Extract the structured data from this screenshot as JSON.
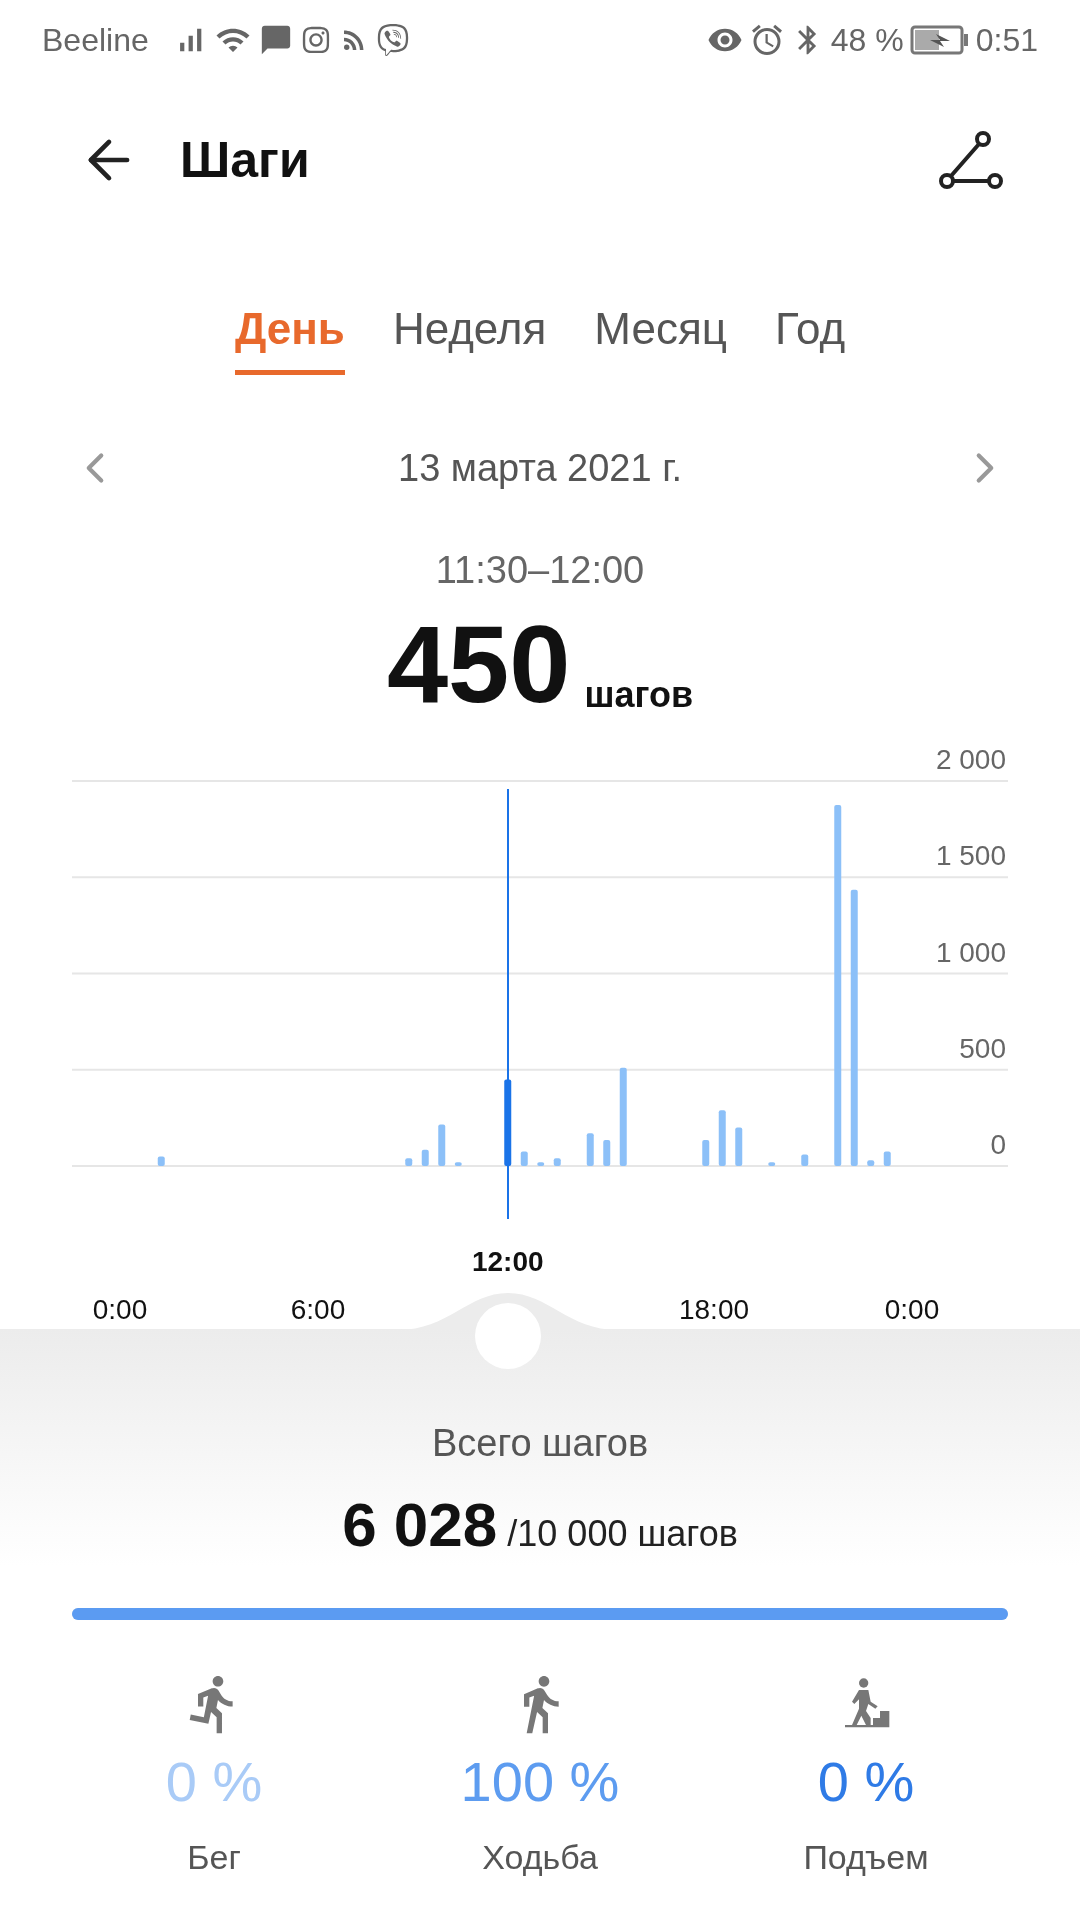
{
  "status_bar": {
    "carrier": "Beeline",
    "battery": "48 %",
    "time": "0:51"
  },
  "header": {
    "title": "Шаги"
  },
  "tabs": [
    {
      "label": "День",
      "selected": true
    },
    {
      "label": "Неделя",
      "selected": false
    },
    {
      "label": "Месяц",
      "selected": false
    },
    {
      "label": "Год",
      "selected": false
    }
  ],
  "date": "13 марта 2021 г.",
  "selection": {
    "range": "11:30–12:00",
    "value": "450",
    "unit": "шагов"
  },
  "cursor": {
    "label": "12:00"
  },
  "chart_data": {
    "type": "bar",
    "grid": true,
    "stacked": true,
    "x": [
      0.25,
      0.75,
      1.25,
      1.75,
      2.25,
      2.75,
      3.25,
      3.75,
      4.25,
      4.75,
      5.25,
      5.75,
      6.25,
      6.75,
      7.25,
      7.75,
      8.25,
      8.75,
      9.25,
      9.75,
      10.25,
      10.75,
      11.25,
      11.75,
      12.25,
      12.75,
      13.25,
      13.75,
      14.25,
      14.75,
      15.25,
      15.75,
      16.25,
      16.75,
      17.25,
      17.75,
      18.25,
      18.75,
      19.25,
      19.75,
      20.25,
      20.75,
      21.25,
      21.75,
      22.25,
      22.75,
      23.25,
      23.75
    ],
    "series": [
      {
        "color": "#8cc0f8",
        "values": [
          0,
          0,
          50,
          0,
          0,
          0,
          0,
          0,
          0,
          0,
          0,
          0,
          0,
          0,
          0,
          0,
          0,
          40,
          85,
          215,
          20,
          0,
          0,
          null,
          75,
          20,
          40,
          0,
          170,
          135,
          510,
          0,
          0,
          0,
          0,
          135,
          290,
          200,
          0,
          20,
          0,
          60,
          0,
          1875,
          1435,
          30,
          75,
          0
        ]
      },
      {
        "color": "#1a73e8",
        "values": [
          null,
          null,
          null,
          null,
          null,
          null,
          null,
          null,
          null,
          null,
          null,
          null,
          null,
          null,
          null,
          null,
          null,
          null,
          null,
          null,
          null,
          null,
          null,
          450,
          null,
          null,
          null,
          null,
          null,
          null,
          null,
          null,
          null,
          null,
          null,
          null,
          null,
          null,
          null,
          null,
          null,
          null,
          null,
          null,
          null,
          null,
          null,
          null
        ]
      }
    ],
    "xlim": [
      -1.4545,
      26.909
    ],
    "ylim": [
      0,
      2000
    ],
    "xticks": [
      {
        "value": 0,
        "label": "0:00"
      },
      {
        "value": 6,
        "label": "6:00"
      },
      {
        "value": 18,
        "label": "18:00"
      },
      {
        "value": 24,
        "label": "0:00"
      }
    ],
    "yticks": [
      {
        "value": 0,
        "label": "0"
      },
      {
        "value": 500,
        "label": "500"
      },
      {
        "value": 1000,
        "label": "1 000"
      },
      {
        "value": 1500,
        "label": "1 500"
      },
      {
        "value": 2000,
        "label": "2 000"
      }
    ]
  },
  "summary": {
    "title": "Всего шагов",
    "total": "6 028",
    "goal": "/10 000 шагов",
    "level": 1
  },
  "activities": [
    {
      "kind": "run",
      "percent": "0 %",
      "label": "Бег",
      "color": "#a9cbf7"
    },
    {
      "kind": "walk",
      "percent": "100 %",
      "label": "Ходьба",
      "color": "#5d9cf0"
    },
    {
      "kind": "climb",
      "percent": "0 %",
      "label": "Подъем",
      "color": "#2f7be6"
    }
  ]
}
